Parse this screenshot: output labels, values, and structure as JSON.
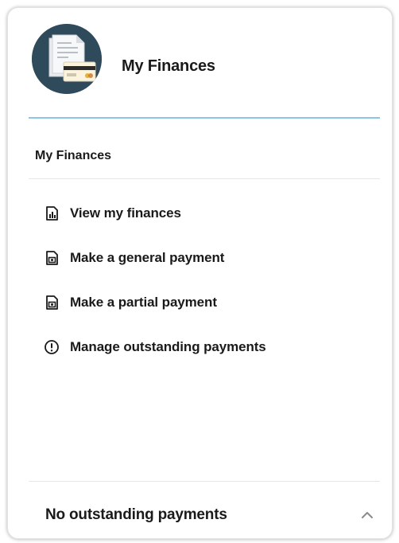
{
  "header": {
    "title": "My Finances",
    "avatar_icon": "invoice-card-icon",
    "accent_color": "#8cc6e6",
    "avatar_bg": "#2e4a5b"
  },
  "section": {
    "title": "My Finances"
  },
  "menu": {
    "items": [
      {
        "label": "View my finances",
        "icon": "report-chart-icon"
      },
      {
        "label": "Make a general payment",
        "icon": "payment-document-icon"
      },
      {
        "label": "Make a partial payment",
        "icon": "payment-document-icon"
      },
      {
        "label": "Manage outstanding payments",
        "icon": "alert-circle-icon"
      }
    ]
  },
  "footer": {
    "label": "No outstanding payments",
    "toggle_icon": "chevron-up-icon"
  }
}
